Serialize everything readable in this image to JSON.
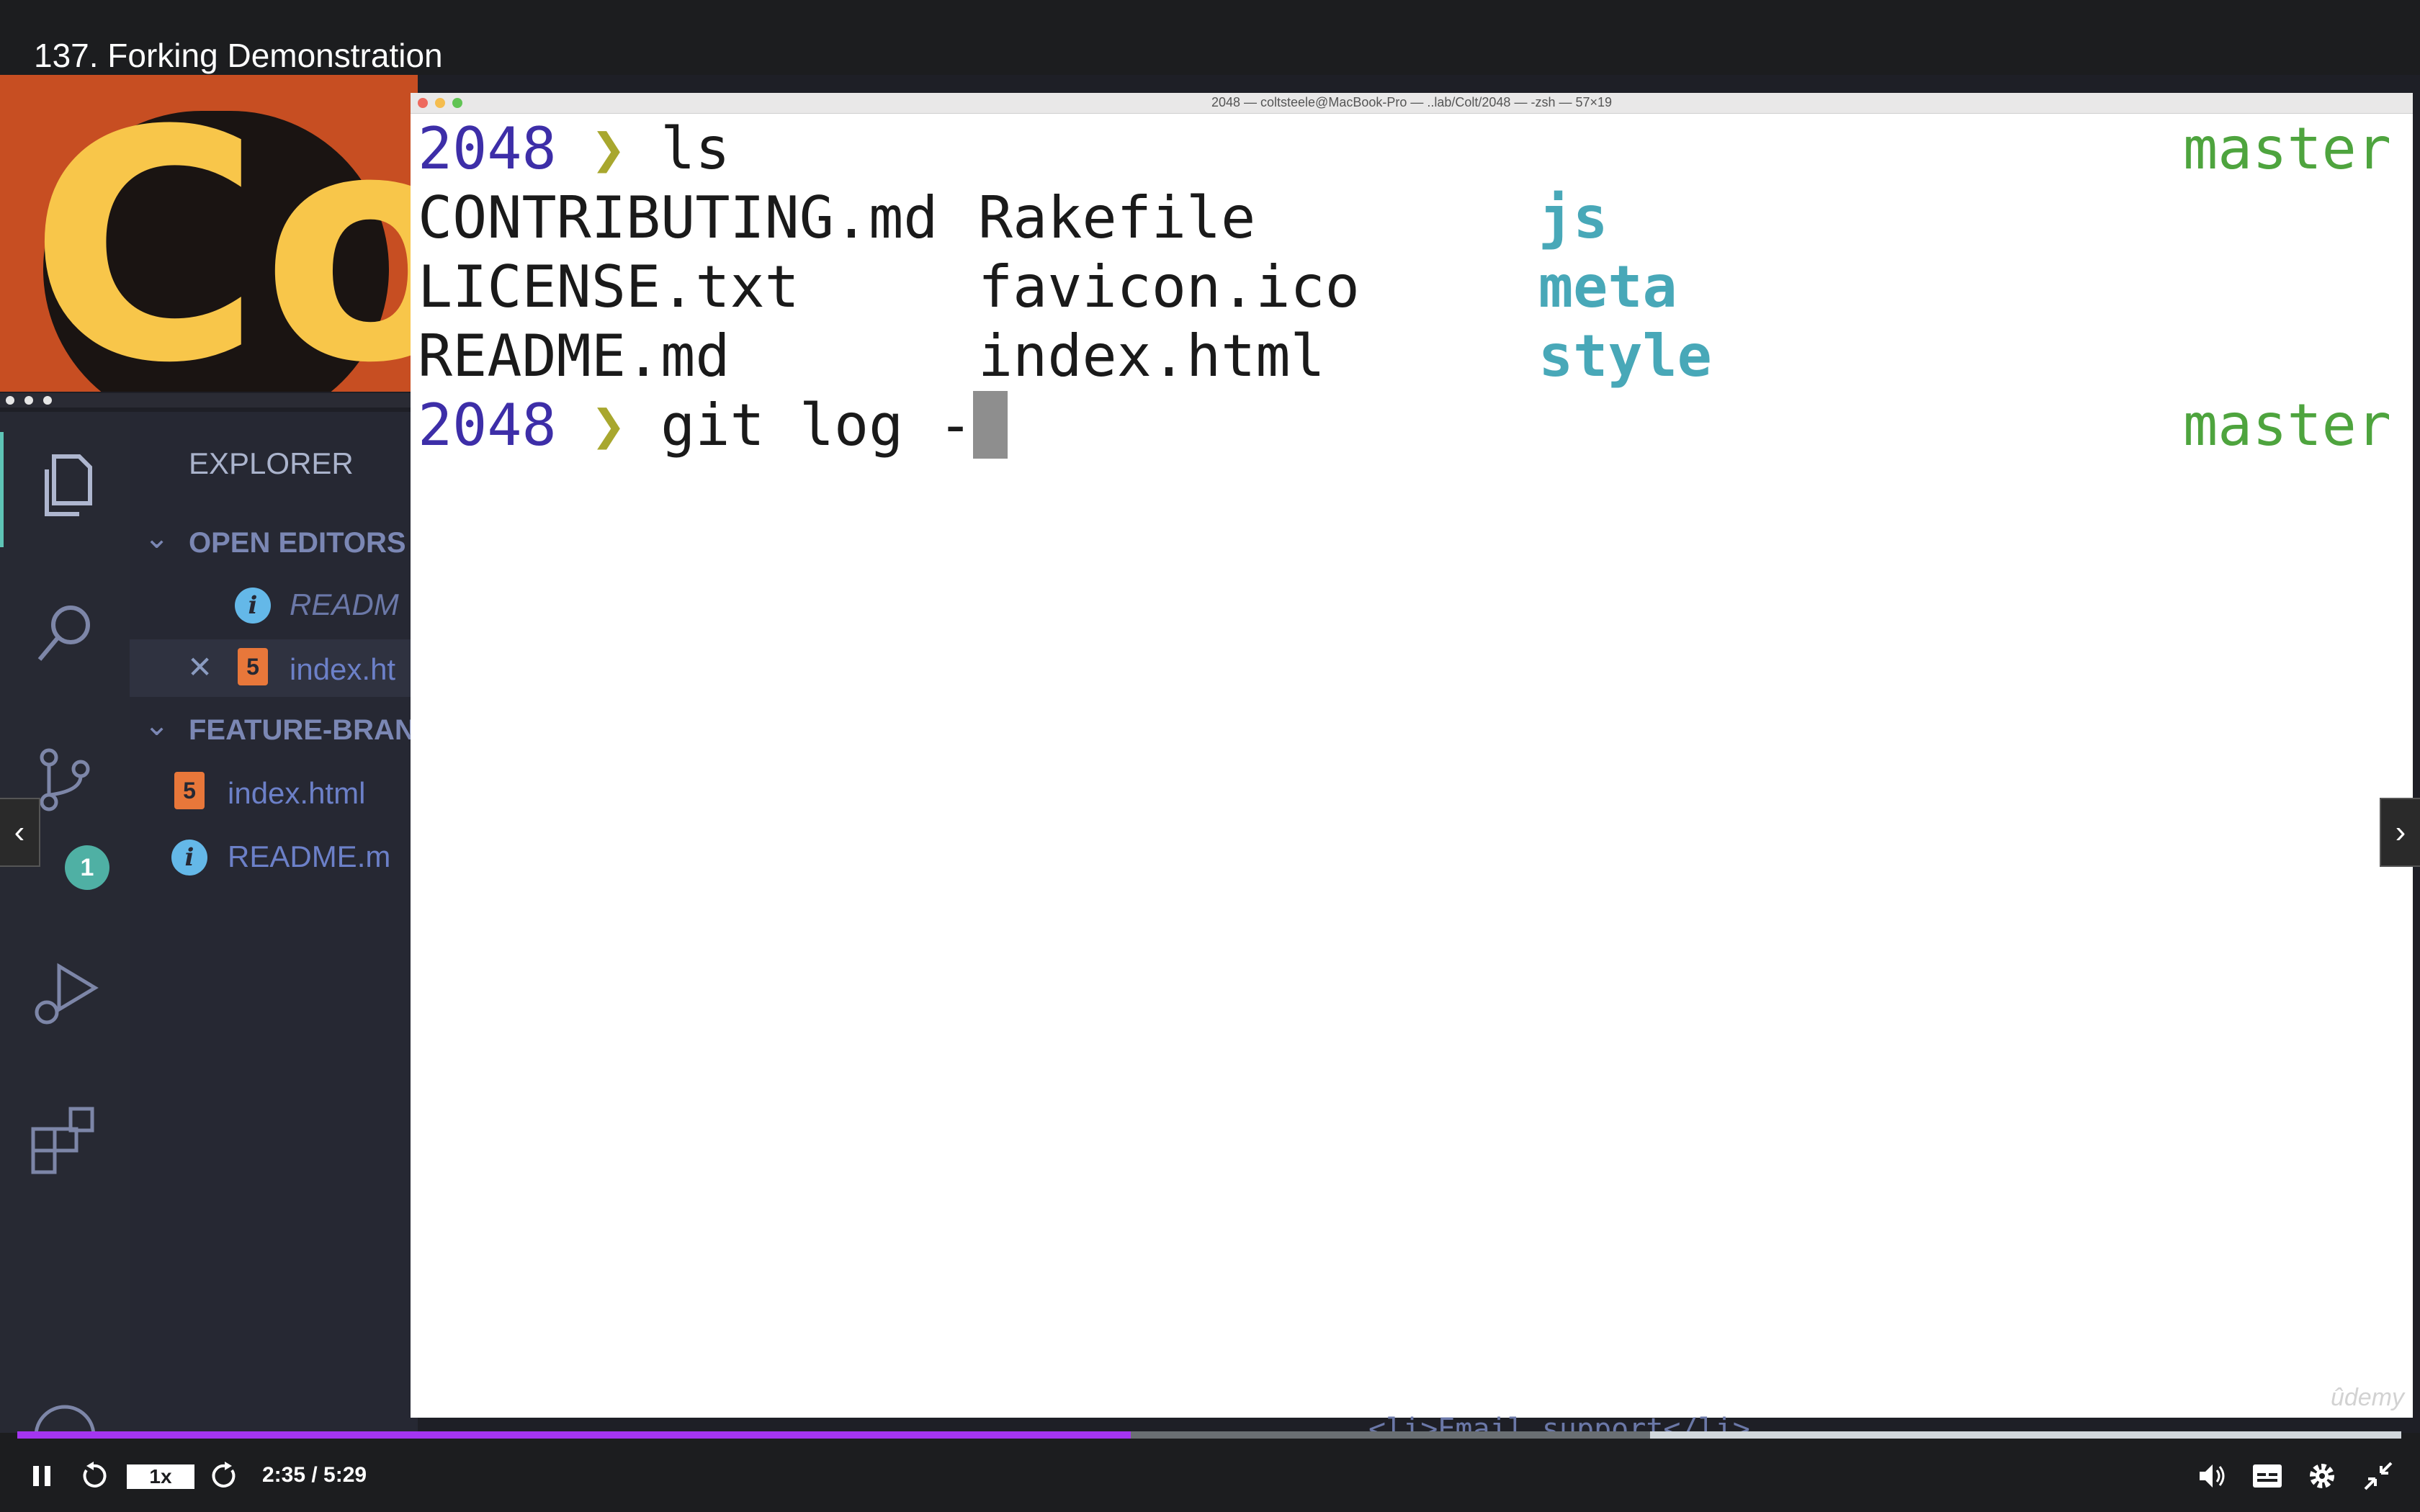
{
  "lecture": {
    "title": "137. Forking Demonstration"
  },
  "terminal": {
    "window_title": "2048 — coltsteele@MacBook-Pro — ..lab/Colt/2048 — -zsh — 57×19",
    "prompt_dir": "2048",
    "prompt_arrow": "❯",
    "branch": "master",
    "cmd1": "ls",
    "ls_rows": [
      [
        "CONTRIBUTING.md",
        "Rakefile",
        "js"
      ],
      [
        "LICENSE.txt",
        "favicon.ico",
        "meta"
      ],
      [
        "README.md",
        "index.html",
        "style"
      ]
    ],
    "cmd2": "git log -",
    "watermark": "ûdemy"
  },
  "vscode": {
    "explorer_title": "EXPLORER",
    "open_editors_label": "OPEN EDITORS",
    "open_editor_1": "READM",
    "open_editor_2": "index.ht",
    "folder_label": "FEATURE-BRAN",
    "file_1": "index.html",
    "file_2": "README.m",
    "scm_badge": "1",
    "code_peek": "<li>Email support</li>"
  },
  "player": {
    "speed": "1x",
    "current_time": "2:35",
    "duration": "5:29",
    "time_display": "2:35 / 5:29",
    "progress_fraction": 0.467,
    "buffered_fraction": 0.685,
    "accent": "#a435f0"
  }
}
